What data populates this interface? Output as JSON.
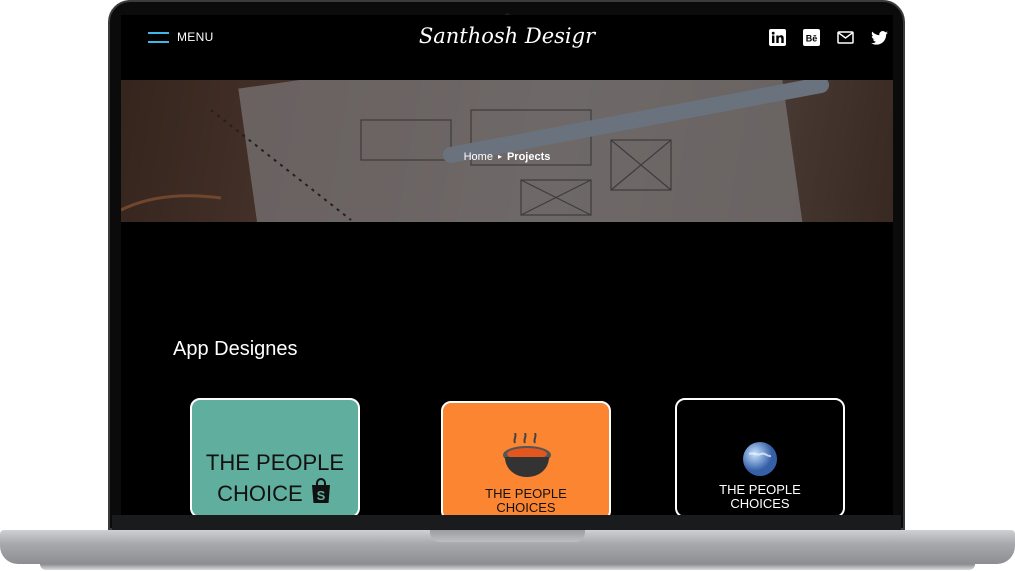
{
  "header": {
    "menu_label": "MENU",
    "logo_text": "Santhosh Desigr",
    "social_icons": [
      "linkedin-icon",
      "behance-icon",
      "mail-icon",
      "twitter-icon"
    ]
  },
  "hero": {
    "breadcrumb": {
      "home": "Home",
      "separator": "▸",
      "current": "Projects"
    }
  },
  "section": {
    "title": "App Designes",
    "cards": [
      {
        "line1": "THE PEOPLE",
        "line2": "CHOICE",
        "icon": "shopping-bag-icon",
        "bg": "#5fae9e"
      },
      {
        "line1": "THE PEOPLE",
        "line2": "CHOICES",
        "icon": "food-pot-icon",
        "bg": "#fb8530"
      },
      {
        "line1": "THE PEOPLE",
        "line2": "CHOICES",
        "icon": "globe-icon",
        "bg": "#000000"
      }
    ]
  },
  "colors": {
    "accent": "#3fb7e8",
    "background": "#000000",
    "text": "#ffffff"
  }
}
